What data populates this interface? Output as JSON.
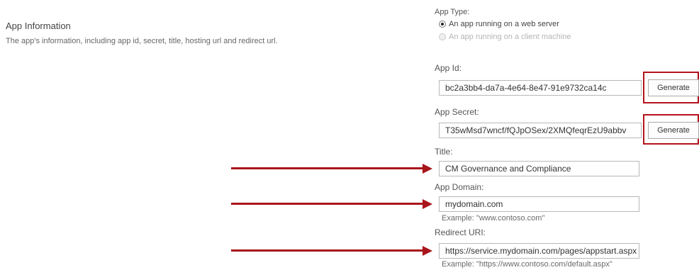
{
  "section": {
    "title": "App Information",
    "description": "The app's information, including app id, secret, title, hosting url and redirect url."
  },
  "app_type": {
    "label": "App Type:",
    "options": [
      {
        "label": "An app running on a web server",
        "selected": true,
        "enabled": true
      },
      {
        "label": "An app running on a client machine",
        "selected": false,
        "enabled": false
      }
    ]
  },
  "app_id": {
    "label": "App Id:",
    "value": "bc2a3bb4-da7a-4e64-8e47-91e9732ca14c",
    "button": "Generate"
  },
  "app_secret": {
    "label": "App Secret:",
    "value": "T35wMsd7wncf/fQJpOSex/2XMQfeqrEzU9abbv",
    "button": "Generate"
  },
  "title_field": {
    "label": "Title:",
    "value": "CM Governance and Compliance"
  },
  "app_domain": {
    "label": "App Domain:",
    "value": "mydomain.com",
    "example": "Example: \"www.contoso.com\""
  },
  "redirect_uri": {
    "label": "Redirect URI:",
    "value": "https://service.mydomain.com/pages/appstart.aspx",
    "example": "Example: \"https://www.contoso.com/default.aspx\""
  },
  "colors": {
    "highlight": "#b3141c",
    "arrow": "#a8151b",
    "input_border": "#b8b8b8"
  }
}
